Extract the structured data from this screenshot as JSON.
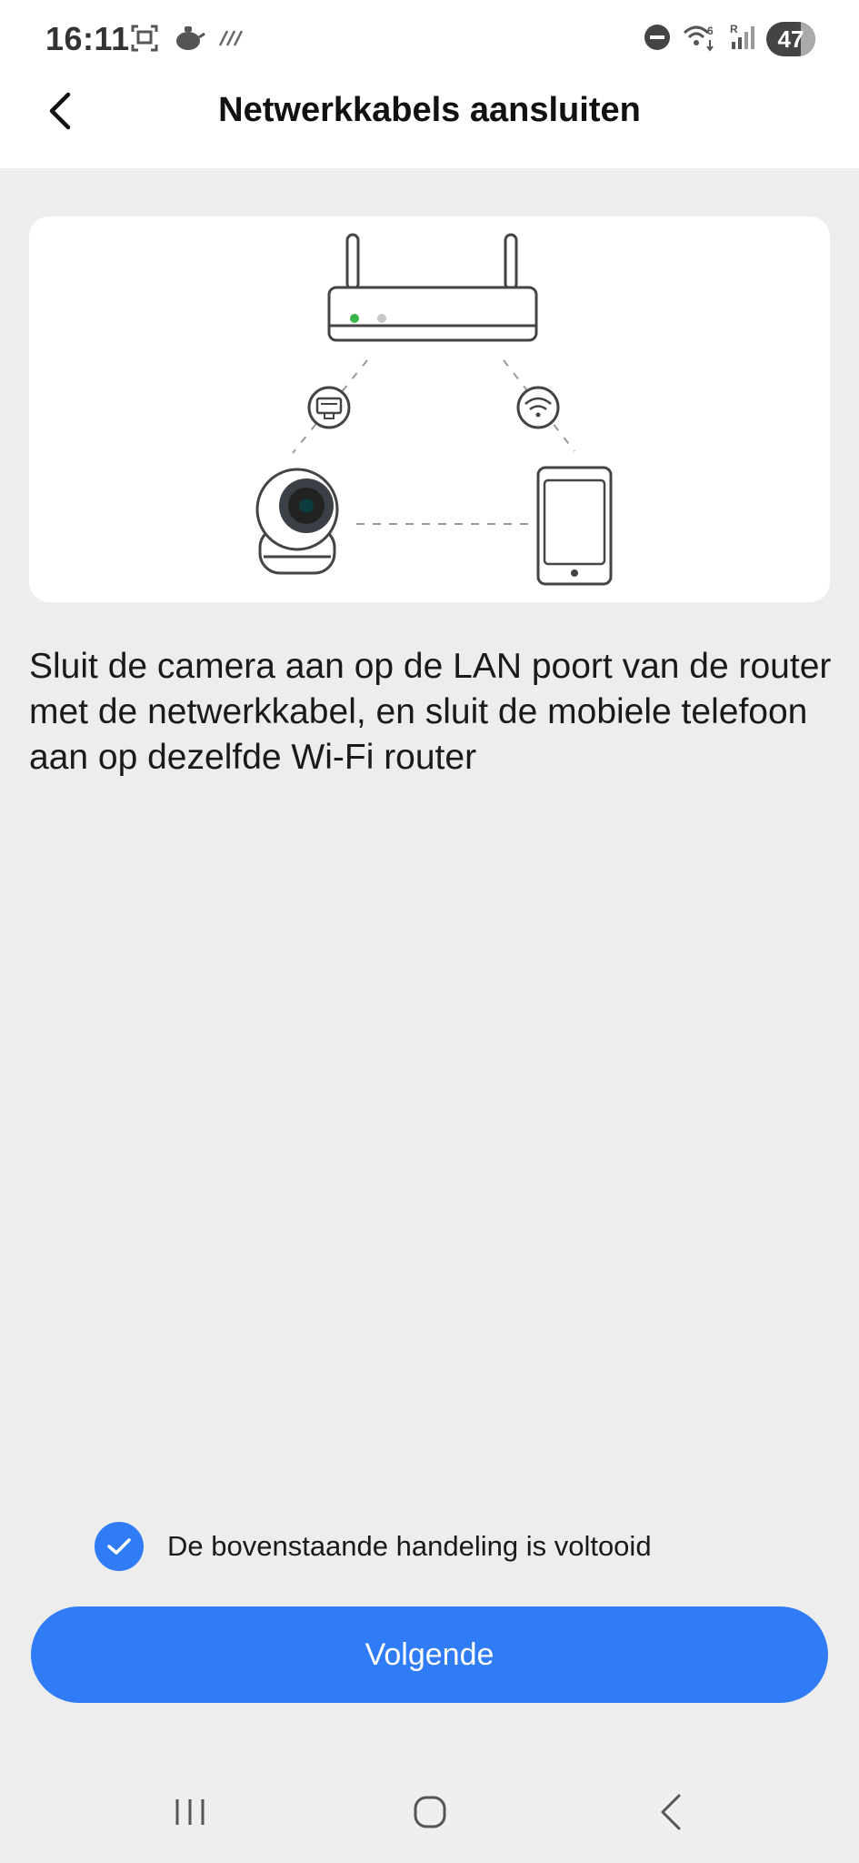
{
  "status_bar": {
    "time": "16:11",
    "battery": "47",
    "left_icons": [
      "screenshot-icon",
      "teapot-icon",
      "slashes-icon"
    ],
    "right_icons": [
      "do-not-disturb-icon",
      "wifi-6-icon",
      "signal-roaming-icon",
      "battery-icon"
    ]
  },
  "header": {
    "title": "Netwerkkabels aansluiten",
    "back_icon": "chevron-left-icon"
  },
  "illustration": {
    "icons": [
      "router-icon",
      "ethernet-icon",
      "wifi-icon",
      "camera-icon",
      "phone-icon"
    ],
    "router_led_color": "#3bb54a"
  },
  "main": {
    "description": "Sluit de camera aan op de LAN poort van de router met de netwerkkabel, en sluit de mobiele telefoon aan op dezelfde Wi-Fi router"
  },
  "confirmation": {
    "checked": true,
    "label": "De bovenstaande handeling is voltooid"
  },
  "actions": {
    "next_label": "Volgende"
  },
  "nav_bar": {
    "items": [
      "recent-apps-icon",
      "home-icon",
      "back-icon"
    ]
  },
  "colors": {
    "accent": "#2f7cf6",
    "background": "#ededee"
  }
}
